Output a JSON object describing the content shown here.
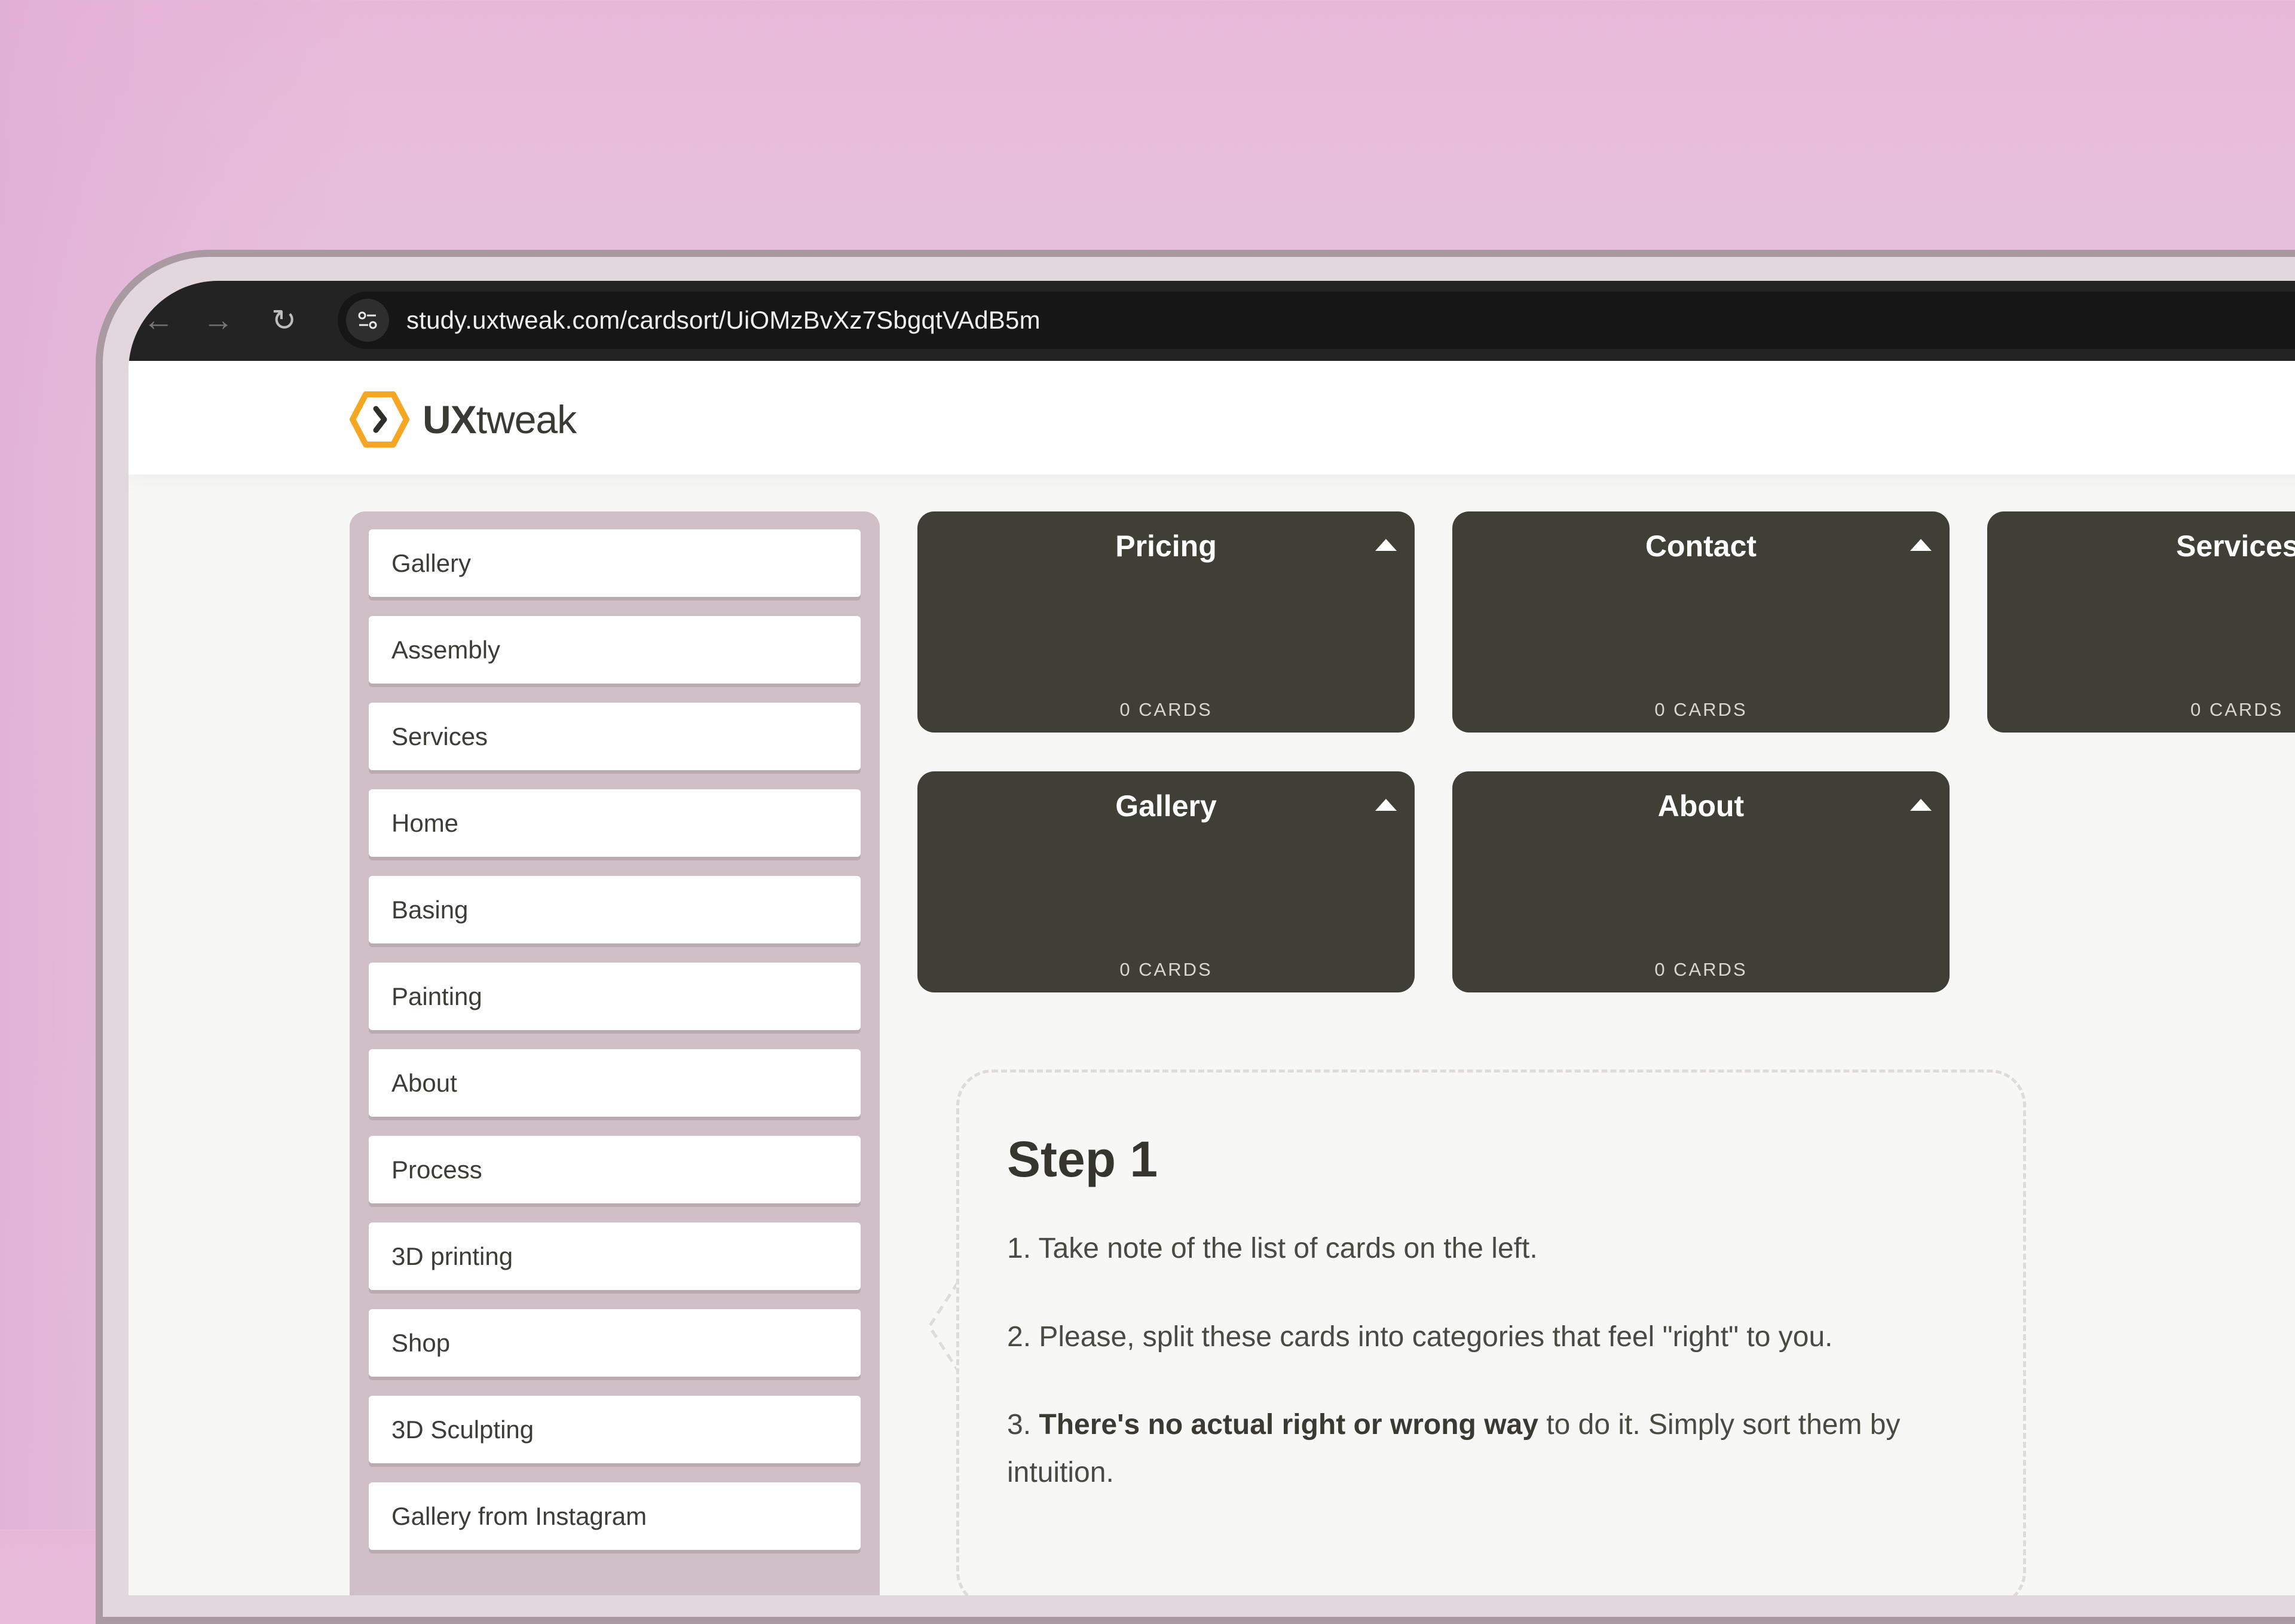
{
  "browser": {
    "url": "study.uxtweak.com/cardsort/UiOMzBvXz7SbgqtVAdB5m",
    "icons": {
      "back": "arrow-left-icon",
      "forward": "arrow-right-icon",
      "reload": "reload-icon",
      "site_settings": "tune-icon"
    }
  },
  "header": {
    "logo_strong": "UX",
    "logo_light": "tweak"
  },
  "cards": [
    "Gallery",
    "Assembly",
    "Services",
    "Home",
    "Basing",
    "Painting",
    "About",
    "Process",
    "3D printing",
    "Shop",
    "3D Sculpting",
    "Gallery from Instagram"
  ],
  "categories": [
    {
      "title": "Pricing",
      "count": "0 CARDS"
    },
    {
      "title": "Contact",
      "count": "0 CARDS"
    },
    {
      "title": "Services",
      "count": "0 CARDS"
    },
    {
      "title": "Gallery",
      "count": "0 CARDS"
    },
    {
      "title": "About",
      "count": "0 CARDS"
    }
  ],
  "instructions": {
    "title": "Step 1",
    "line1": "1. Take note of the list of cards on the left.",
    "line2": "2. Please, split these cards into categories that feel \"right\" to you.",
    "line3_prefix": "3. ",
    "line3_bold": "There's no actual right or wrong way",
    "line3_rest": " to do it. Simply sort them by intuition."
  },
  "colors": {
    "category_bg": "#3f3f36",
    "panel_bg": "#d0bfc6",
    "logo_accent": "#f5a623",
    "toolbar_bg": "#232323"
  }
}
